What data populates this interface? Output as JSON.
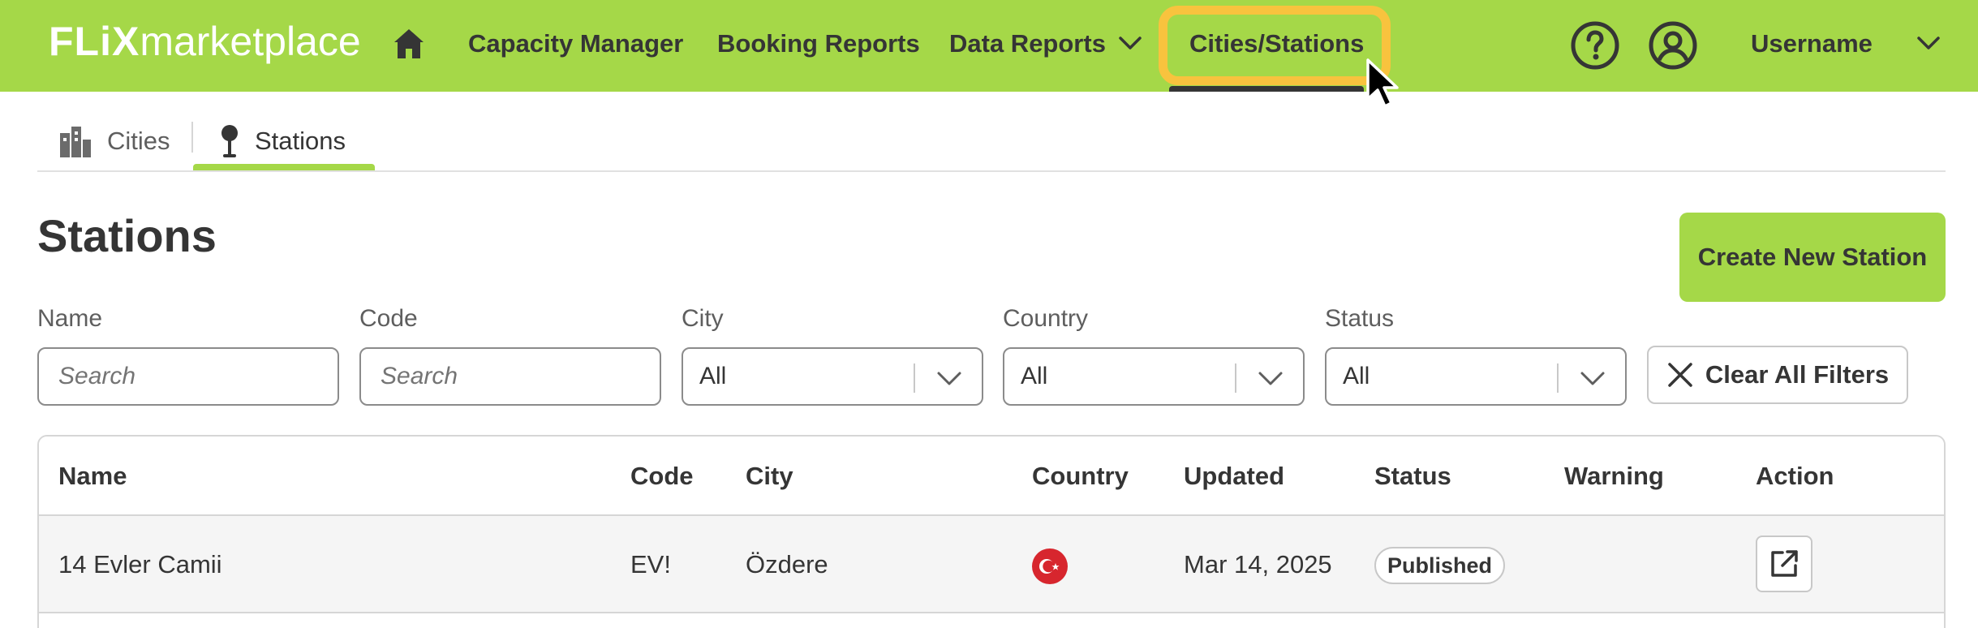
{
  "header": {
    "logo_bold": "FLiX",
    "logo_light": "marketplace",
    "nav": {
      "capacity_manager": "Capacity Manager",
      "booking_reports": "Booking Reports",
      "data_reports": "Data Reports",
      "cities_stations": "Cities/Stations"
    },
    "username": "Username",
    "colors": {
      "bar": "#a5d848",
      "highlight": "#f8c33e"
    }
  },
  "subtabs": {
    "cities": "Cities",
    "stations": "Stations",
    "active": "Stations"
  },
  "page": {
    "title": "Stations",
    "create_button": "Create New Station"
  },
  "filters": {
    "name": {
      "label": "Name",
      "placeholder": "Search"
    },
    "code": {
      "label": "Code",
      "placeholder": "Search"
    },
    "city": {
      "label": "City",
      "value": "All"
    },
    "country": {
      "label": "Country",
      "value": "All"
    },
    "status": {
      "label": "Status",
      "value": "All"
    },
    "clear_button": "Clear All Filters"
  },
  "table": {
    "columns": [
      "Name",
      "Code",
      "City",
      "Country",
      "Updated",
      "Status",
      "Warning",
      "Action"
    ],
    "rows": [
      {
        "name": "14 Evler Camii",
        "code": "EV!",
        "city": "Özdere",
        "country_flag": "turkey-flag-icon",
        "updated": "Mar 14, 2025",
        "status": "Published",
        "warning": ""
      }
    ]
  }
}
